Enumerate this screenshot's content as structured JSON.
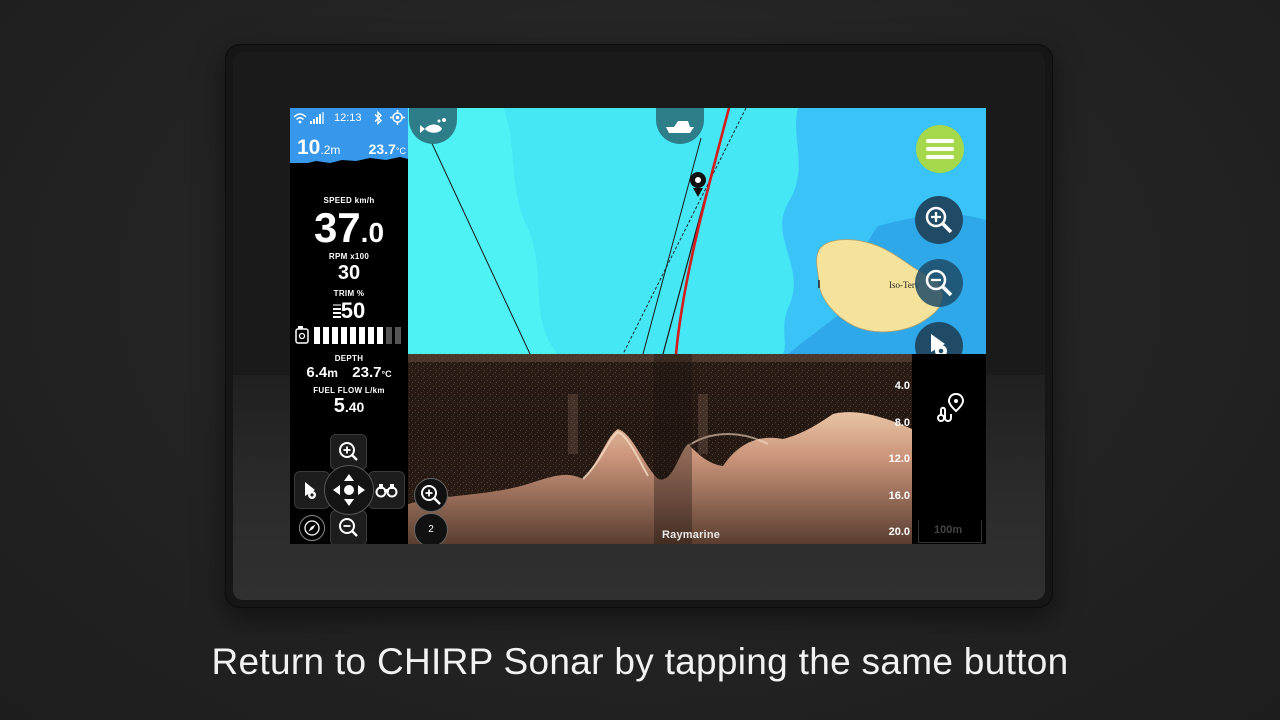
{
  "status_bar": {
    "time": "12:13",
    "icons": [
      "wifi-icon",
      "signal-icon",
      "bluetooth-icon",
      "gps-icon"
    ]
  },
  "header_depth": {
    "value": "10.2",
    "int": "10",
    "dec": ".2",
    "unit": "m"
  },
  "header_temp": {
    "int": "23.7",
    "unit": "°C"
  },
  "instruments": {
    "speed": {
      "label": "SPEED  km/h",
      "int": "37",
      "dec": ".0"
    },
    "rpm": {
      "label": "RPM  x100",
      "value": "30"
    },
    "trim": {
      "label": "TRIM  %",
      "value": "50"
    },
    "fuel_level_fraction": 0.8,
    "depth": {
      "label": "DEPTH",
      "value": "6.4",
      "unit": "m",
      "temp": "23.7",
      "temp_unit": "°C"
    },
    "fuel_flow": {
      "label": "FUEL FLOW  L/km",
      "int": "5",
      "dec": ".40"
    }
  },
  "chart": {
    "island_label": "Iso-Terv",
    "buttons": [
      "menu-icon",
      "zoom-in-icon",
      "zoom-out-icon",
      "waypoint-icon",
      "route-icon"
    ],
    "tabs": [
      "fish-icon",
      "boat-icon"
    ]
  },
  "sonar": {
    "depth_scale": [
      "4.0",
      "8.0",
      "12.0",
      "16.0",
      "20.0"
    ],
    "range_label": "100m",
    "zoom_level": "2",
    "brand": "Raymarine"
  },
  "caption": "Return to CHIRP Sonar by tapping the same button",
  "colors": {
    "chart_water_deep": "#3ac3f7",
    "chart_water_shallow": "#4ef2f5",
    "land": "#f6e39b",
    "header_blue": "#3797ea",
    "menu_green": "#a5d84a",
    "button_dark": "#1f4b66",
    "track_red": "#d51b1b"
  }
}
